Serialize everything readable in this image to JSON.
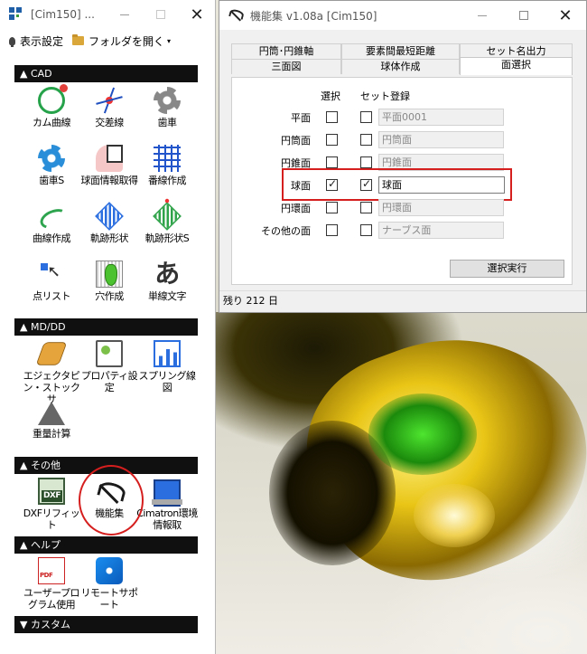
{
  "left_window": {
    "title": "[Cim150] ...",
    "toolbar": {
      "settings_label": "表示設定",
      "open_folder_label": "フォルダを開く",
      "open_folder_caret": "▾"
    },
    "sections": {
      "cad": "▲ CAD",
      "mddd": "▲ MD/DD",
      "other": "▲ その他",
      "help": "▲ ヘルプ",
      "custom": "▼ カスタム"
    },
    "cad_items": [
      "カム曲線",
      "交差線",
      "歯車",
      "歯車S",
      "球面情報取得",
      "番線作成",
      "曲線作成",
      "軌跡形状",
      "軌跡形状S",
      "点リスト",
      "穴作成",
      "単線文字"
    ],
    "mddd_items": [
      "エジェクタピン・ストックサ",
      "プロパティ設定",
      "スプリング線図",
      "重量計算"
    ],
    "other_items": [
      "DXFリフィット",
      "機能集",
      "Cimatron環境情報取"
    ],
    "help_items": [
      "ユーザープログラム使用",
      "リモートサポート"
    ],
    "icons": {
      "app": "app-grid-icon",
      "dxf_text": "DXF",
      "letter_a": "あ"
    },
    "title_buttons": {
      "close": "✕"
    }
  },
  "dialog": {
    "title": "機能集 v1.08a [Cim150]",
    "title_buttons": {
      "close": "✕"
    },
    "tabs_row1": [
      "円筒･円錐軸",
      "要素間最短距離",
      "セット名出力"
    ],
    "tabs_row2": [
      "三面図",
      "球体作成",
      "面選択"
    ],
    "active_tab": "面選択",
    "columns": {
      "select": "選択",
      "set_register": "セット登録"
    },
    "rows": [
      {
        "label": "平面",
        "select": false,
        "register": false,
        "text": "平面0001",
        "active": false
      },
      {
        "label": "円筒面",
        "select": false,
        "register": false,
        "text": "円筒面",
        "active": false
      },
      {
        "label": "円錐面",
        "select": false,
        "register": false,
        "text": "円錐面",
        "active": false
      },
      {
        "label": "球面",
        "select": true,
        "register": true,
        "text": "球面",
        "active": true
      },
      {
        "label": "円環面",
        "select": false,
        "register": false,
        "text": "円環面",
        "active": false
      },
      {
        "label": "その他の面",
        "select": false,
        "register": false,
        "text": "ナーブス面",
        "active": false
      }
    ],
    "execute_button": "選択実行",
    "status": "残り 212 日"
  },
  "colors": {
    "highlight_red": "#d51e1e",
    "section_bg": "#101010"
  }
}
